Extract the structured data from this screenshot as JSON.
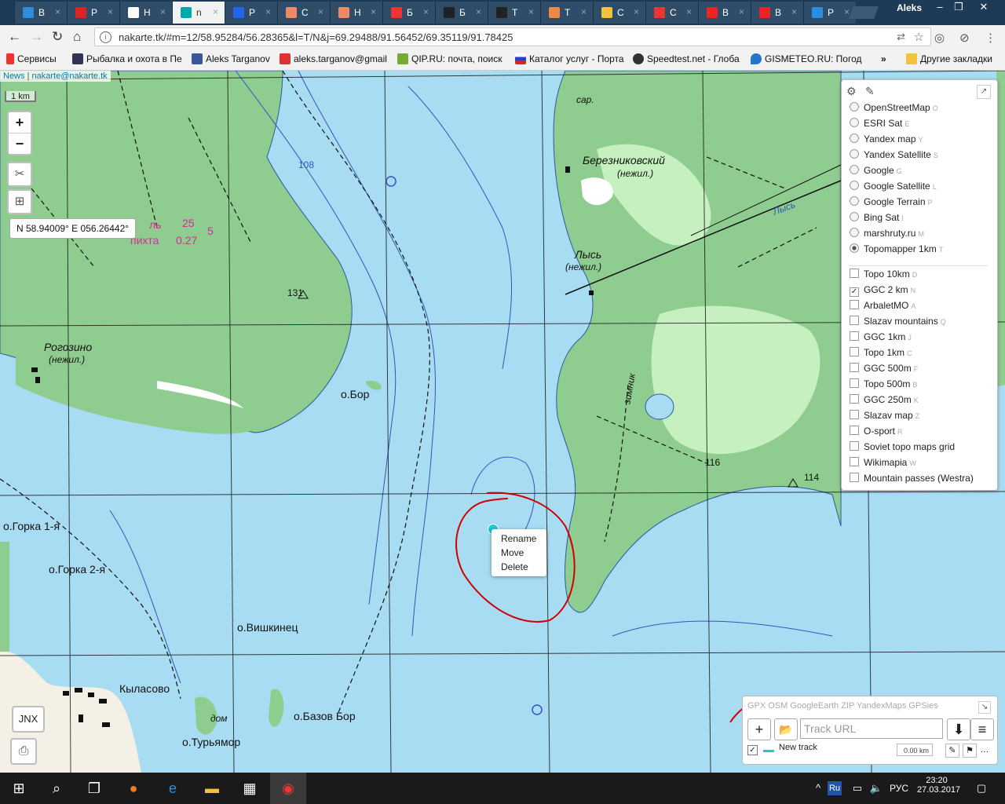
{
  "tabs": [
    {
      "title": "В"
    },
    {
      "title": "Р"
    },
    {
      "title": "Н"
    },
    {
      "title": "n",
      "active": true
    },
    {
      "title": "Р"
    },
    {
      "title": "С"
    },
    {
      "title": "Н"
    },
    {
      "title": "Б"
    },
    {
      "title": "Б"
    },
    {
      "title": "Т"
    },
    {
      "title": "Т"
    },
    {
      "title": "С"
    },
    {
      "title": "С"
    },
    {
      "title": "В"
    },
    {
      "title": "В"
    },
    {
      "title": "Р"
    }
  ],
  "user": "Aleks",
  "url": "nakarte.tk/#m=12/58.95284/56.28365&l=T/N&j=69.29488/91.56452/69.35119/91.78425",
  "bookmarks": [
    {
      "label": "Сервисы"
    },
    {
      "label": "Рыбалка и охота в Пе"
    },
    {
      "label": "Aleks Targanov"
    },
    {
      "label": "aleks.targanov@gmail"
    },
    {
      "label": "QIP.RU: почта, поиск"
    },
    {
      "label": "Каталог услуг - Порта"
    },
    {
      "label": "Speedtest.net - Глоба"
    },
    {
      "label": "GISMETEO.RU: Погод"
    },
    {
      "label": "Другие закладки"
    }
  ],
  "attribution": {
    "news": "News",
    "sep": "|",
    "email": "nakarte@nakarte.tk"
  },
  "scale": "1 km",
  "zoom": {
    "in": "+",
    "out": "−"
  },
  "coords": "N 58.94009°   E 056.26442°",
  "map_labels": [
    "Березниковский",
    "(нежил.)",
    "Лысь",
    "(нежил.)",
    "сар.",
    "Рогозино",
    "(нежил.)",
    "о.Бор",
    "о.Горка 1-я",
    "о.Горка 2-я",
    "о.Вишкинец",
    "Кыласово",
    "о.Базов Бор",
    "о.Турьямор",
    "дом",
    "зимник",
    "Лысь",
    "131",
    "116",
    "114",
    "108"
  ],
  "pink_labels": [
    "25",
    "ль",
    "пихта",
    "0.27",
    "5"
  ],
  "layers": {
    "base": [
      {
        "name": "OpenStreetMap",
        "key": "O",
        "selected": false
      },
      {
        "name": "ESRI Sat",
        "key": "E",
        "selected": false
      },
      {
        "name": "Yandex map",
        "key": "Y",
        "selected": false
      },
      {
        "name": "Yandex Satellite",
        "key": "S",
        "selected": false
      },
      {
        "name": "Google",
        "key": "G",
        "selected": false
      },
      {
        "name": "Google Satellite",
        "key": "L",
        "selected": false
      },
      {
        "name": "Google Terrain",
        "key": "P",
        "selected": false
      },
      {
        "name": "Bing Sat",
        "key": "I",
        "selected": false
      },
      {
        "name": "marshruty.ru",
        "key": "M",
        "selected": false
      },
      {
        "name": "Topomapper 1km",
        "key": "T",
        "selected": true
      }
    ],
    "overlays": [
      {
        "name": "Topo 10km",
        "key": "D",
        "checked": false
      },
      {
        "name": "GGC 2 km",
        "key": "N",
        "checked": true
      },
      {
        "name": "ArbaletMO",
        "key": "A",
        "checked": false
      },
      {
        "name": "Slazav mountains",
        "key": "Q",
        "checked": false
      },
      {
        "name": "GGC 1km",
        "key": "J",
        "checked": false
      },
      {
        "name": "Topo 1km",
        "key": "C",
        "checked": false
      },
      {
        "name": "GGC 500m",
        "key": "F",
        "checked": false
      },
      {
        "name": "Topo 500m",
        "key": "B",
        "checked": false
      },
      {
        "name": "GGC 250m",
        "key": "K",
        "checked": false
      },
      {
        "name": "Slazav map",
        "key": "Z",
        "checked": false
      },
      {
        "name": "O-sport",
        "key": "R",
        "checked": false
      },
      {
        "name": "Soviet topo maps grid",
        "key": "",
        "checked": false
      },
      {
        "name": "Wikimapia",
        "key": "W",
        "checked": false
      },
      {
        "name": "Mountain passes (Westra)",
        "key": "",
        "checked": false
      }
    ]
  },
  "context_menu": [
    "Rename",
    "Move",
    "Delete"
  ],
  "tracks": {
    "services": "GPX OSM GoogleEarth ZIP YandexMaps GPSies",
    "url_placeholder": "Track URL",
    "track_name": "New track",
    "track_length": "0.00 km",
    "track_color": "#1ec8d6"
  },
  "jnx": "JNX",
  "taskbar": {
    "lang": "РУС",
    "lang_badge": "Ru",
    "time": "23:20",
    "date": "27.03.2017"
  },
  "colors": {
    "water": "#a8dcf2",
    "forest": "#8fcc8f",
    "forest_light": "#c7f0c0",
    "annotation": "#d00000"
  }
}
